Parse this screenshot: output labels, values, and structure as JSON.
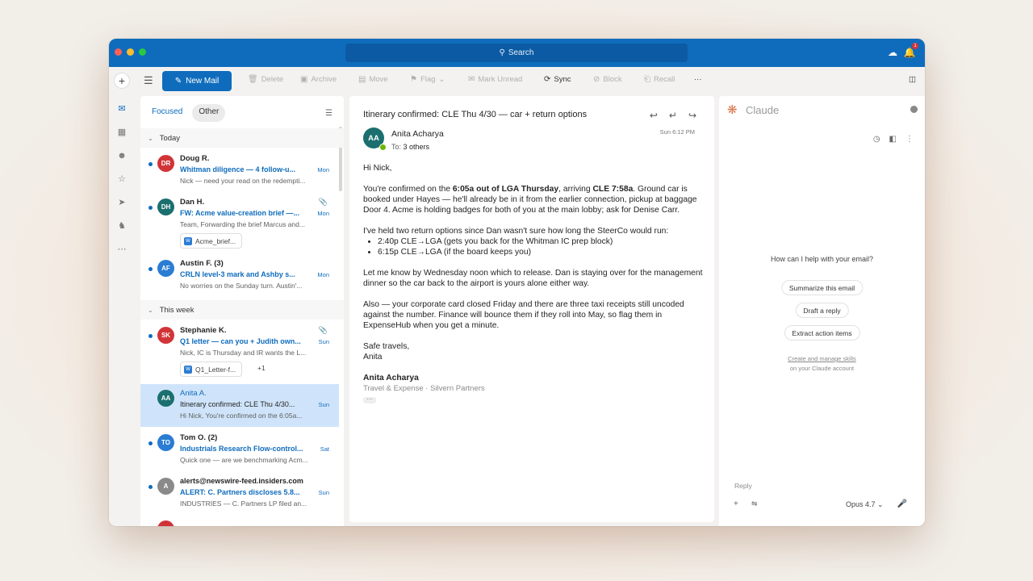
{
  "toolbar": {
    "search": "Search",
    "new_mail": "New Mail",
    "buttons": [
      "Delete",
      "Archive",
      "Move",
      "Flag",
      "Mark Unread",
      "Sync",
      "Block",
      "Recall"
    ],
    "more": "···"
  },
  "list": {
    "tabs": [
      "Focused",
      "Other"
    ],
    "groups": [
      "Today",
      "This week"
    ],
    "messages": [
      {
        "initials": "DR",
        "color": "#d13438",
        "from": "Doug R.",
        "subject": "Whitman diligence — 4 follow-u...",
        "date": "Mon",
        "preview": "Nick — need your read on the redempti..."
      },
      {
        "initials": "DH",
        "color": "#1b6f6f",
        "from": "Dan H.",
        "subject": "FW: Acme value-creation brief —...",
        "date": "Mon",
        "preview": "Team, Forwarding the brief Marcus and...",
        "attachment": "Acme_brief..."
      },
      {
        "initials": "AF",
        "color": "#2b7cd3",
        "from": "Austin F. (3)",
        "subject": "CRLN level-3 mark and Ashby s...",
        "date": "Mon",
        "preview": "No worries on the Sunday turn. Austin'..."
      },
      {
        "initials": "SK",
        "color": "#d13438",
        "from": "Stephanie K.",
        "subject": "Q1 letter — can you + Judith own...",
        "date": "Sun",
        "preview": "Nick, IC is Thursday and IR wants the L...",
        "attachment": "Q1_Letter-f...",
        "attachment_more": "+1"
      },
      {
        "initials": "AA",
        "color": "#1b6f6f",
        "from": "Anita A.",
        "subject": "Itinerary confirmed: CLE Thu 4/30...",
        "date": "Sun",
        "preview": "Hi Nick, You're confirmed on the 6:05a..."
      },
      {
        "initials": "TO",
        "color": "#2b7cd3",
        "from": "Tom O. (2)",
        "subject": "Industrials Research Flow-control...",
        "date": "Sat",
        "preview": "Quick one — are we benchmarking Acm..."
      },
      {
        "initials": "A",
        "color": "#8a8a8a",
        "from": "alerts@newswire-feed.insiders.com",
        "subject": "ALERT: C. Partners discloses 5.8...",
        "date": "Sun",
        "preview": "INDUSTRIES — C. Partners LP filed an..."
      }
    ]
  },
  "reading": {
    "subject": "Itinerary confirmed: CLE Thu 4/30 — car + return options",
    "avatar": "AA",
    "sender": "Anita Acharya",
    "to_label": "To:",
    "to_value": "3 others",
    "date": "Sun 6:12 PM",
    "greeting": "Hi Nick,",
    "p1_a": "You're confirmed on the ",
    "p1_b": "6:05a out of LGA Thursday",
    "p1_c": ", arriving ",
    "p1_d": "CLE 7:58a",
    "p1_e": ". Ground car is booked under Hayes — he'll already be in it from the earlier connection, pickup at baggage Door 4. Acme is holding badges for both of you at the main lobby; ask for Denise Carr.",
    "p2": "I've held two return options since Dan wasn't sure how long the SteerCo would run:",
    "options": [
      "2:40p CLE→LGA (gets you back for the Whitman IC prep block)",
      "6:15p CLE→LGA (if the board keeps you)"
    ],
    "p3": "Let me know by Wednesday noon which to release. Dan is staying over for the management dinner so the car back to the airport is yours alone either way.",
    "p4": "Also — your corporate card closed Friday and there are three taxi receipts still uncoded against the number. Finance will bounce them if they roll into May, so flag them in ExpenseHub when you get a minute.",
    "signoff1": "Safe travels,",
    "signoff2": "Anita",
    "sig_name": "Anita Acharya",
    "sig_title": "Travel & Expense · Silvern Partners",
    "more": "···"
  },
  "claude": {
    "title": "Claude",
    "question": "How can I help with your email?",
    "chips": [
      "Summarize this email",
      "Draft a reply",
      "Extract action items"
    ],
    "link": "Create and manage skills",
    "link_sub": "on your Claude account",
    "reply": "Reply",
    "model": "Opus 4.7"
  }
}
